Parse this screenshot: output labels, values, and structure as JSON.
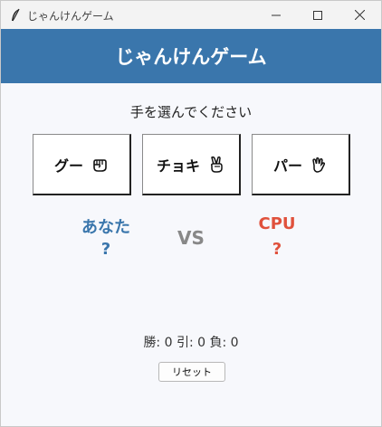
{
  "window": {
    "title": "じゃんけんゲーム",
    "icons": {
      "app": "feather-icon",
      "minimize": "minimize-icon",
      "maximize": "maximize-icon",
      "close": "close-icon"
    }
  },
  "header": {
    "title": "じゃんけんゲーム",
    "background": "#3a76ac"
  },
  "prompt": "手を選んでください",
  "choices": [
    {
      "label": "グー",
      "icon": "fist-icon"
    },
    {
      "label": "チョキ",
      "icon": "victory-hand-icon"
    },
    {
      "label": "パー",
      "icon": "open-hand-icon"
    }
  ],
  "players": {
    "you": {
      "label": "あなた",
      "hand": "?",
      "color": "#3a76ac"
    },
    "cpu": {
      "label": "CPU",
      "hand": "?",
      "color": "#e0513c"
    }
  },
  "vs": "VS",
  "score": "勝: 0  引: 0  負: 0",
  "reset_label": "リセット"
}
